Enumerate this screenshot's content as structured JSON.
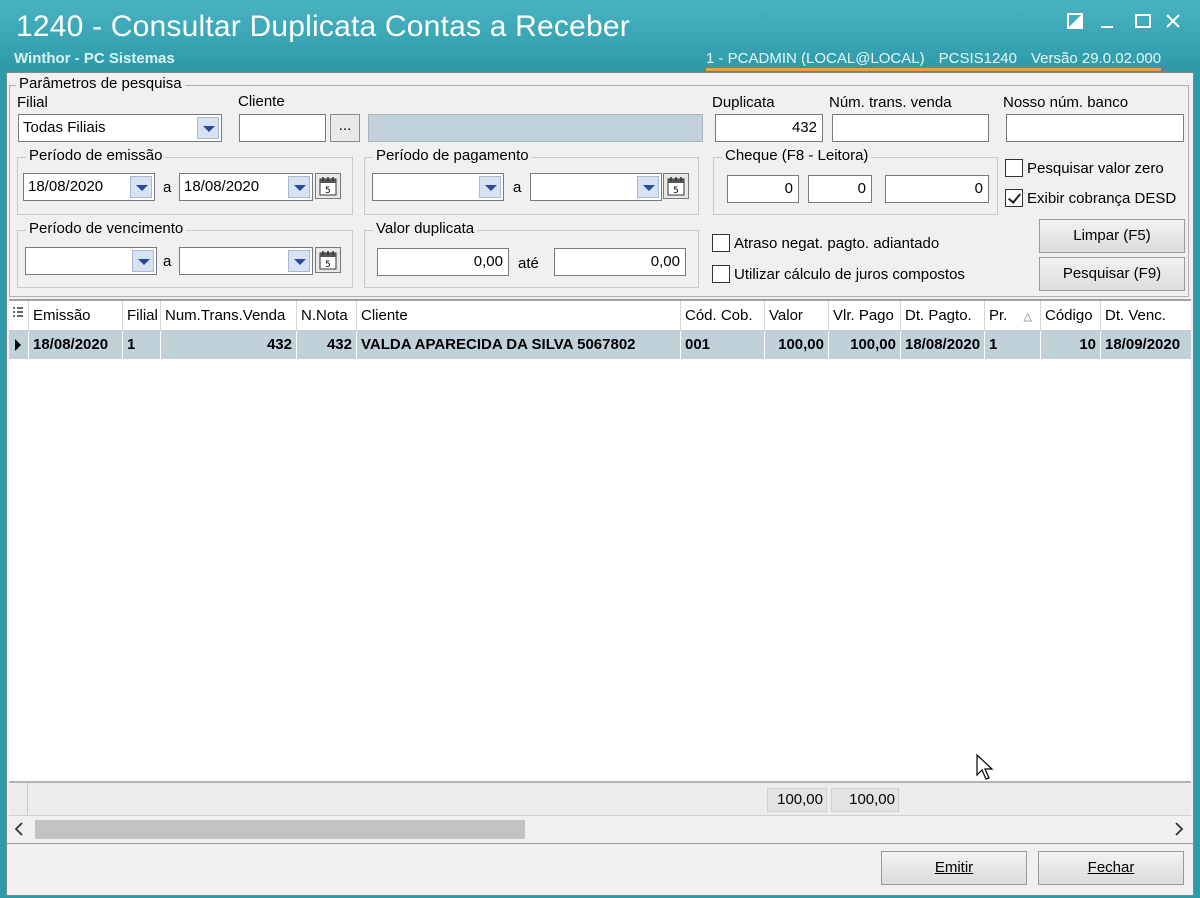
{
  "window": {
    "title": "1240 - Consultar Duplicata Contas a Receber",
    "subtitle": "Winthor - PC Sistemas",
    "user": "1 - PCADMIN (LOCAL@LOCAL)",
    "program": "PCSIS1240",
    "version": "Versão  29.0.02.000"
  },
  "params": {
    "group_title": "Parâmetros de pesquisa",
    "filial_label": "Filial",
    "filial_value": "Todas Filiais",
    "cliente_label": "Cliente",
    "cliente_code": "",
    "cliente_button": "...",
    "cliente_name": "",
    "duplicata_label": "Duplicata",
    "duplicata_value": "432",
    "num_trans_label": "Núm. trans. venda",
    "num_trans_value": "",
    "nosso_num_label": "Nosso núm. banco",
    "nosso_num_value": "",
    "emissao": {
      "title": "Período de emissão",
      "from": "18/08/2020",
      "sep": "a",
      "to": "18/08/2020"
    },
    "pagamento": {
      "title": "Período de pagamento",
      "from": "",
      "sep": "a",
      "to": ""
    },
    "cheque": {
      "title": "Cheque (F8 - Leitora)",
      "v1": "0",
      "v2": "0",
      "v3": "0"
    },
    "vencimento": {
      "title": "Período de vencimento",
      "from": "",
      "sep": "a",
      "to": ""
    },
    "valor": {
      "title": "Valor duplicata",
      "from": "0,00",
      "sep": "até",
      "to": "0,00"
    },
    "pesquisar_zero_label": "Pesquisar valor zero",
    "pesquisar_zero_checked": false,
    "exibir_cobranca_label": "Exibir cobrança  DESD",
    "exibir_cobranca_checked": true,
    "atraso_label": "Atraso negat. pagto. adiantado",
    "atraso_checked": false,
    "juros_label": "Utilizar cálculo de juros compostos",
    "juros_checked": false,
    "limpar_label": "Limpar (F5)",
    "pesquisar_label": "Pesquisar (F9)"
  },
  "grid": {
    "columns": [
      "Emissão",
      "Filial",
      "Num.Trans.Venda",
      "N.Nota",
      "Cliente",
      "Cód. Cob.",
      "Valor",
      "Vlr. Pago",
      "Dt. Pagto.",
      "Pr.",
      "Código",
      "Dt. Venc."
    ],
    "rows": [
      [
        "18/08/2020",
        "1",
        "432",
        "432",
        "VALDA APARECIDA DA SILVA 5067802",
        "001",
        "100,00",
        "100,00",
        "18/08/2020",
        "1",
        "10",
        "18/09/2020"
      ]
    ],
    "totals": {
      "valor": "100,00",
      "vlr_pago": "100,00"
    }
  },
  "footer": {
    "emitir_label": "Emitir",
    "fechar_label": "Fechar"
  }
}
